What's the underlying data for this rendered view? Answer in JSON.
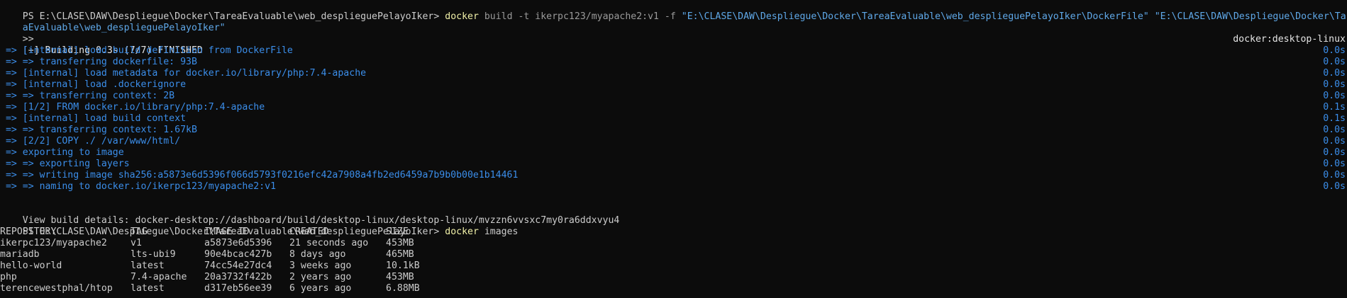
{
  "terminal": {
    "build_prompt": "PS E:\\CLASE\\DAW\\Despliegue\\Docker\\TareaEvaluable\\web_desplieguePelayoIker>",
    "build_cmd": "docker",
    "build_args": "build -t ikerpc123/myapache2:v1 -f",
    "build_file_arg": "\"E:\\CLASE\\DAW\\Despliegue\\Docker\\TareaEvaluable\\web_desplieguePelayoIker\\DockerFile\"",
    "build_ctx_arg_part1": "\"E:\\CLASE\\DAW\\Despliegue\\Docker\\Tare",
    "build_ctx_arg_part2": "aEvaluable\\web_desplieguePelayoIker\"",
    "continuation": ">>",
    "building_status": "[+] Building 0.3s (7/7) FINISHED",
    "builder_name": "docker:desktop-linux",
    "steps": [
      {
        "text": " => [internal] load build definition from DockerFile",
        "time": "0.0s"
      },
      {
        "text": " => => transferring dockerfile: 93B",
        "time": "0.0s"
      },
      {
        "text": " => [internal] load metadata for docker.io/library/php:7.4-apache",
        "time": "0.0s"
      },
      {
        "text": " => [internal] load .dockerignore",
        "time": "0.0s"
      },
      {
        "text": " => => transferring context: 2B",
        "time": "0.0s"
      },
      {
        "text": " => [1/2] FROM docker.io/library/php:7.4-apache",
        "time": "0.1s"
      },
      {
        "text": " => [internal] load build context",
        "time": "0.1s"
      },
      {
        "text": " => => transferring context: 1.67kB",
        "time": "0.0s"
      },
      {
        "text": " => [2/2] COPY ./ /var/www/html/",
        "time": "0.0s"
      },
      {
        "text": " => exporting to image",
        "time": "0.0s"
      },
      {
        "text": " => => exporting layers",
        "time": "0.0s"
      },
      {
        "text": " => => writing image sha256:a5873e6d5396f066d5793f0216efc42a7908a4fb2ed6459a7b9b0b00e1b14461",
        "time": "0.0s"
      },
      {
        "text": " => => naming to docker.io/ikerpc123/myapache2:v1",
        "time": "0.0s"
      }
    ],
    "view_details": "View build details: docker-desktop://dashboard/build/desktop-linux/desktop-linux/mvzzn6vvsxc7my0ra6ddxvyu4",
    "images_prompt": "PS E:\\CLASE\\DAW\\Despliegue\\Docker\\TareaEvaluable\\web_desplieguePelayoIker>",
    "images_cmd": "docker",
    "images_args": "images",
    "table_headers": [
      "REPOSITORY",
      "TAG",
      "IMAGE ID",
      "CREATED",
      "SIZE"
    ],
    "table_rows": [
      [
        "ikerpc123/myapache2",
        "v1",
        "a5873e6d5396",
        "21 seconds ago",
        "453MB"
      ],
      [
        "mariadb",
        "lts-ubi9",
        "90e4bcac427b",
        "8 days ago",
        "465MB"
      ],
      [
        "hello-world",
        "latest",
        "74cc54e27dc4",
        "3 weeks ago",
        "10.1kB"
      ],
      [
        "php",
        "7.4-apache",
        "20a3732f422b",
        "2 years ago",
        "453MB"
      ],
      [
        "terencewestphal/htop",
        "latest",
        "d317eb56ee39",
        "6 years ago",
        "6.88MB"
      ]
    ],
    "colors": {
      "background": "#0c0c0c",
      "foreground": "#cccccc",
      "command": "#f0f0a8",
      "string": "#5fa8e8",
      "step": "#3b8eea"
    }
  }
}
